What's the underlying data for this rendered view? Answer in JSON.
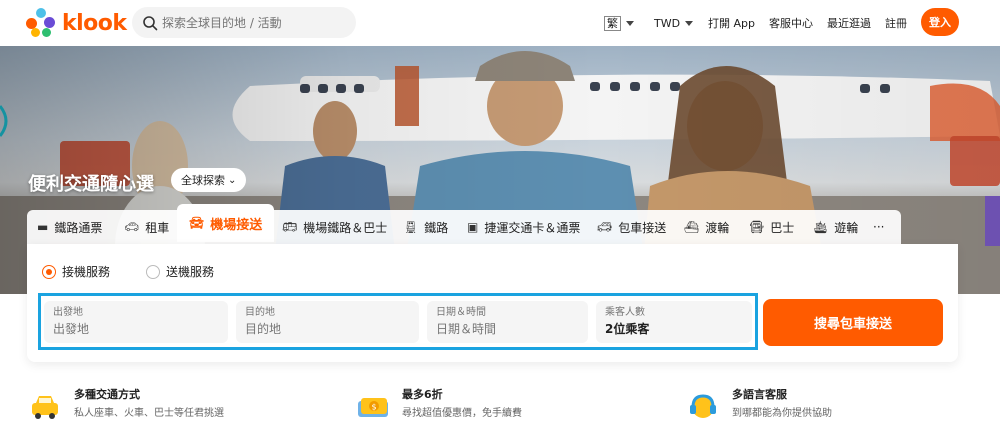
{
  "header": {
    "logo_text": "klook",
    "search_placeholder": "探索全球目的地 / 活動",
    "lang": "繁",
    "currency": "TWD",
    "open_app": "打開 App",
    "support": "客服中心",
    "recent": "最近逛過",
    "register": "註冊",
    "login": "登入"
  },
  "hero": {
    "title": "便利交通隨心選",
    "explore_label": "全球探索"
  },
  "tabs": [
    {
      "label": "鐵路通票",
      "icon": "train-pass-icon"
    },
    {
      "label": "租車",
      "icon": "car-icon"
    },
    {
      "label": "機場接送",
      "icon": "airport-transfer-icon"
    },
    {
      "label": "機場鐵路＆巴士",
      "icon": "airport-bus-icon"
    },
    {
      "label": "鐵路",
      "icon": "rail-icon"
    },
    {
      "label": "捷運交通卡＆通票",
      "icon": "metro-card-icon"
    },
    {
      "label": "包車接送",
      "icon": "private-car-icon"
    },
    {
      "label": "渡輪",
      "icon": "ferry-icon"
    },
    {
      "label": "巴士",
      "icon": "bus-icon"
    },
    {
      "label": "遊輪",
      "icon": "cruise-icon"
    },
    {
      "label": "···",
      "icon": "more-icon"
    }
  ],
  "booking": {
    "radio_pickup": "接機服務",
    "radio_dropoff": "送機服務",
    "selected": "pickup",
    "from_label": "出發地",
    "from_placeholder": "出發地",
    "to_label": "目的地",
    "to_placeholder": "目的地",
    "datetime_label": "日期＆時間",
    "datetime_placeholder": "日期＆時間",
    "passengers_label": "乘客人數",
    "passengers_value": "2位乘客",
    "search_button": "搜尋包車接送"
  },
  "features": [
    {
      "title": "多種交通方式",
      "desc": "私人座車、火車、巴士等任君挑選",
      "icon": "taxi-icon"
    },
    {
      "title": "最多6折",
      "desc": "尋找超值優惠價，免手續費",
      "icon": "money-ticket-icon"
    },
    {
      "title": "多語言客服",
      "desc": "到哪都能為你提供協助",
      "icon": "headset-icon"
    }
  ],
  "colors": {
    "brand": "#ff5b00",
    "highlight_border": "#1aa3e0"
  }
}
